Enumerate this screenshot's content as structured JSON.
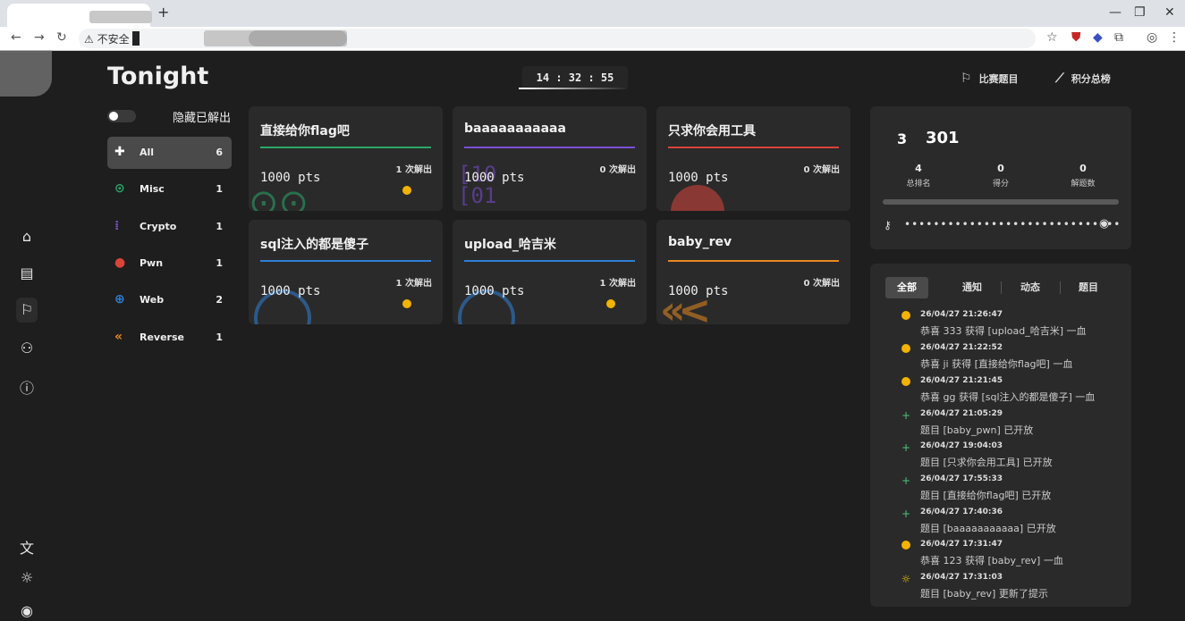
{
  "browser": {
    "security_label": "⚠ 不安全",
    "new_tab_label": "+"
  },
  "app": {
    "brand": "Tonight",
    "clock": "14 : 32 : 55",
    "nav": {
      "challenges_label": "比赛题目",
      "scoreboard_label": "积分总榜"
    }
  },
  "sidebar": {
    "hide_solved_label": "隐藏已解出",
    "categories": [
      {
        "name": "All",
        "count": "6",
        "icon": "puzzle-icon"
      },
      {
        "name": "Misc",
        "count": "1",
        "icon": "gamepad-icon"
      },
      {
        "name": "Crypto",
        "count": "1",
        "icon": "binary-icon"
      },
      {
        "name": "Pwn",
        "count": "1",
        "icon": "bomb-icon"
      },
      {
        "name": "Web",
        "count": "2",
        "icon": "globe-icon"
      },
      {
        "name": "Reverse",
        "count": "1",
        "icon": "rewind-icon"
      }
    ]
  },
  "challenges": [
    {
      "title": "直接给你flag吧",
      "points": "1000 pts",
      "solves": "1 次解出",
      "solved": true,
      "accent": "#2aa86b",
      "category": "Misc"
    },
    {
      "title": "baaaaaaaaaaa",
      "points": "1000 pts",
      "solves": "0 次解出",
      "solved": false,
      "accent": "#7b4fd6",
      "category": "Crypto"
    },
    {
      "title": "只求你会用工具",
      "points": "1000 pts",
      "solves": "0 次解出",
      "solved": false,
      "accent": "#d9433a",
      "category": "Pwn"
    },
    {
      "title": "sql注入的都是傻子",
      "points": "1000 pts",
      "solves": "1 次解出",
      "solved": true,
      "accent": "#2f7fd6",
      "category": "Web"
    },
    {
      "title": "upload_哈吉米",
      "points": "1000 pts",
      "solves": "1 次解出",
      "solved": true,
      "accent": "#2f7fd6",
      "category": "Web"
    },
    {
      "title": "baby_rev",
      "points": "1000 pts",
      "solves": "0 次解出",
      "solved": false,
      "accent": "#e58a1f",
      "category": "Reverse"
    }
  ],
  "team": {
    "rank_badge": "3",
    "name": "301",
    "stats": [
      {
        "value": "4",
        "label": "总排名"
      },
      {
        "value": "0",
        "label": "得分"
      },
      {
        "value": "0",
        "label": "解题数"
      }
    ],
    "token_mask": "••••••••••••••••••••••••••••••"
  },
  "feed": {
    "tabs": [
      "全部",
      "通知",
      "动态",
      "题目"
    ],
    "events": [
      {
        "type": "blood",
        "time": "26/04/27 21:26:47",
        "text": "恭喜 333 获得 [upload_哈吉米] 一血"
      },
      {
        "type": "blood",
        "time": "26/04/27 21:22:52",
        "text": "恭喜 ji 获得 [直接给你flag吧] 一血"
      },
      {
        "type": "blood",
        "time": "26/04/27 21:21:45",
        "text": "恭喜 gg 获得 [sql注入的都是傻子] 一血"
      },
      {
        "type": "new",
        "time": "26/04/27 21:05:29",
        "text": "题目 [baby_pwn] 已开放"
      },
      {
        "type": "new",
        "time": "26/04/27 19:04:03",
        "text": "题目 [只求你会用工具] 已开放"
      },
      {
        "type": "new",
        "time": "26/04/27 17:55:33",
        "text": "题目 [直接给你flag吧] 已开放"
      },
      {
        "type": "new",
        "time": "26/04/27 17:40:36",
        "text": "题目 [baaaaaaaaaaa] 已开放"
      },
      {
        "type": "blood",
        "time": "26/04/27 17:31:47",
        "text": "恭喜 123 获得 [baby_rev] 一血"
      },
      {
        "type": "hint",
        "time": "26/04/27 17:31:03",
        "text": "题目 [baby_rev] 更新了提示"
      }
    ]
  }
}
